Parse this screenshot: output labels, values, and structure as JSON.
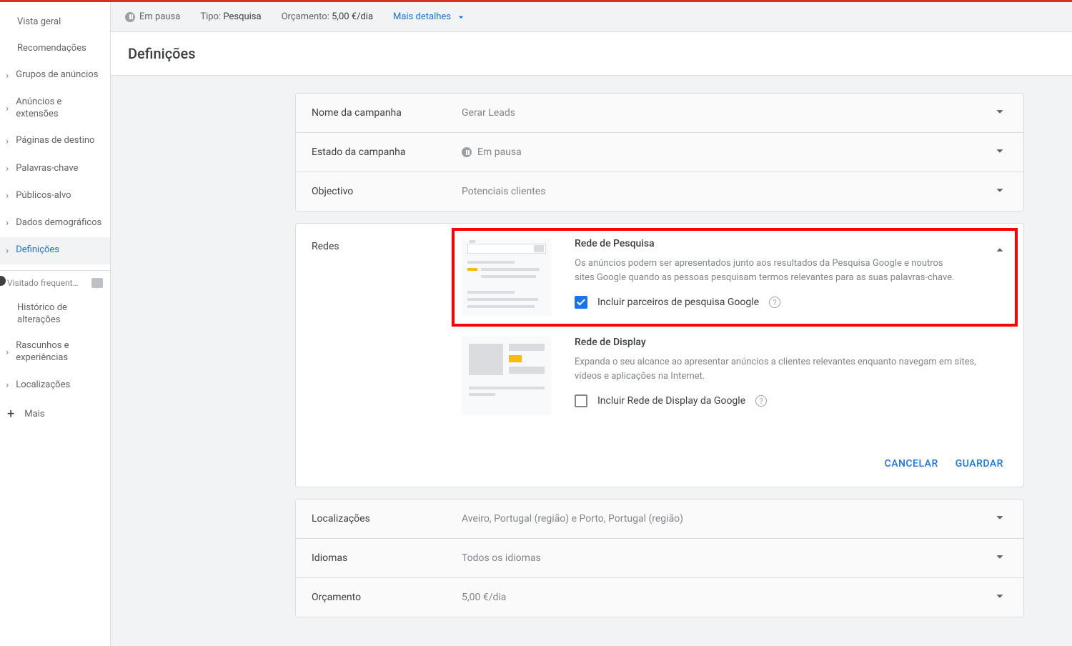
{
  "info_bar": {
    "status": "Em pausa",
    "type_label": "Tipo:",
    "type_value": "Pesquisa",
    "budget_label": "Orçamento:",
    "budget_value": "5,00 €/dia",
    "more": "Mais detalhes"
  },
  "sidebar": {
    "items": [
      {
        "label": "Vista geral",
        "chev": false
      },
      {
        "label": "Recomendações",
        "chev": false
      },
      {
        "label": "Grupos de anúncios",
        "chev": true
      },
      {
        "label": "Anúncios e extensões",
        "chev": true
      },
      {
        "label": "Páginas de destino",
        "chev": true
      },
      {
        "label": "Palavras-chave",
        "chev": true
      },
      {
        "label": "Públicos-alvo",
        "chev": true
      },
      {
        "label": "Dados demográficos",
        "chev": true
      },
      {
        "label": "Definições",
        "chev": true,
        "active": true
      }
    ],
    "section": "Visitado frequent…",
    "items2": [
      {
        "label": "Histórico de alterações",
        "chev": false
      },
      {
        "label": "Rascunhos e experiências",
        "chev": true
      },
      {
        "label": "Localizações",
        "chev": true
      }
    ],
    "more": "Mais"
  },
  "page_title": "Definições",
  "summary": {
    "campaign_name_label": "Nome da campanha",
    "campaign_name_value": "Gerar Leads",
    "campaign_status_label": "Estado da campanha",
    "campaign_status_value": "Em pausa",
    "objective_label": "Objectivo",
    "objective_value": "Potenciais clientes"
  },
  "networks": {
    "label": "Redes",
    "search": {
      "title": "Rede de Pesquisa",
      "desc": "Os anúncios podem ser apresentados junto aos resultados da Pesquisa Google e noutros sites Google quando as pessoas pesquisam termos relevantes para as suas palavras-chave.",
      "checkbox": "Incluir parceiros de pesquisa Google",
      "checked": true
    },
    "display": {
      "title": "Rede de Display",
      "desc": "Expanda o seu alcance ao apresentar anúncios a clientes relevantes enquanto navegam em sites, vídeos e aplicações na Internet.",
      "checkbox": "Incluir Rede de Display da Google",
      "checked": false
    },
    "cancel": "CANCELAR",
    "save": "GUARDAR"
  },
  "more_rows": {
    "locations_label": "Localizações",
    "locations_value": "Aveiro, Portugal (região) e Porto, Portugal (região)",
    "languages_label": "Idiomas",
    "languages_value": "Todos os idiomas",
    "budget_label": "Orçamento",
    "budget_value": "5,00 €/dia"
  }
}
